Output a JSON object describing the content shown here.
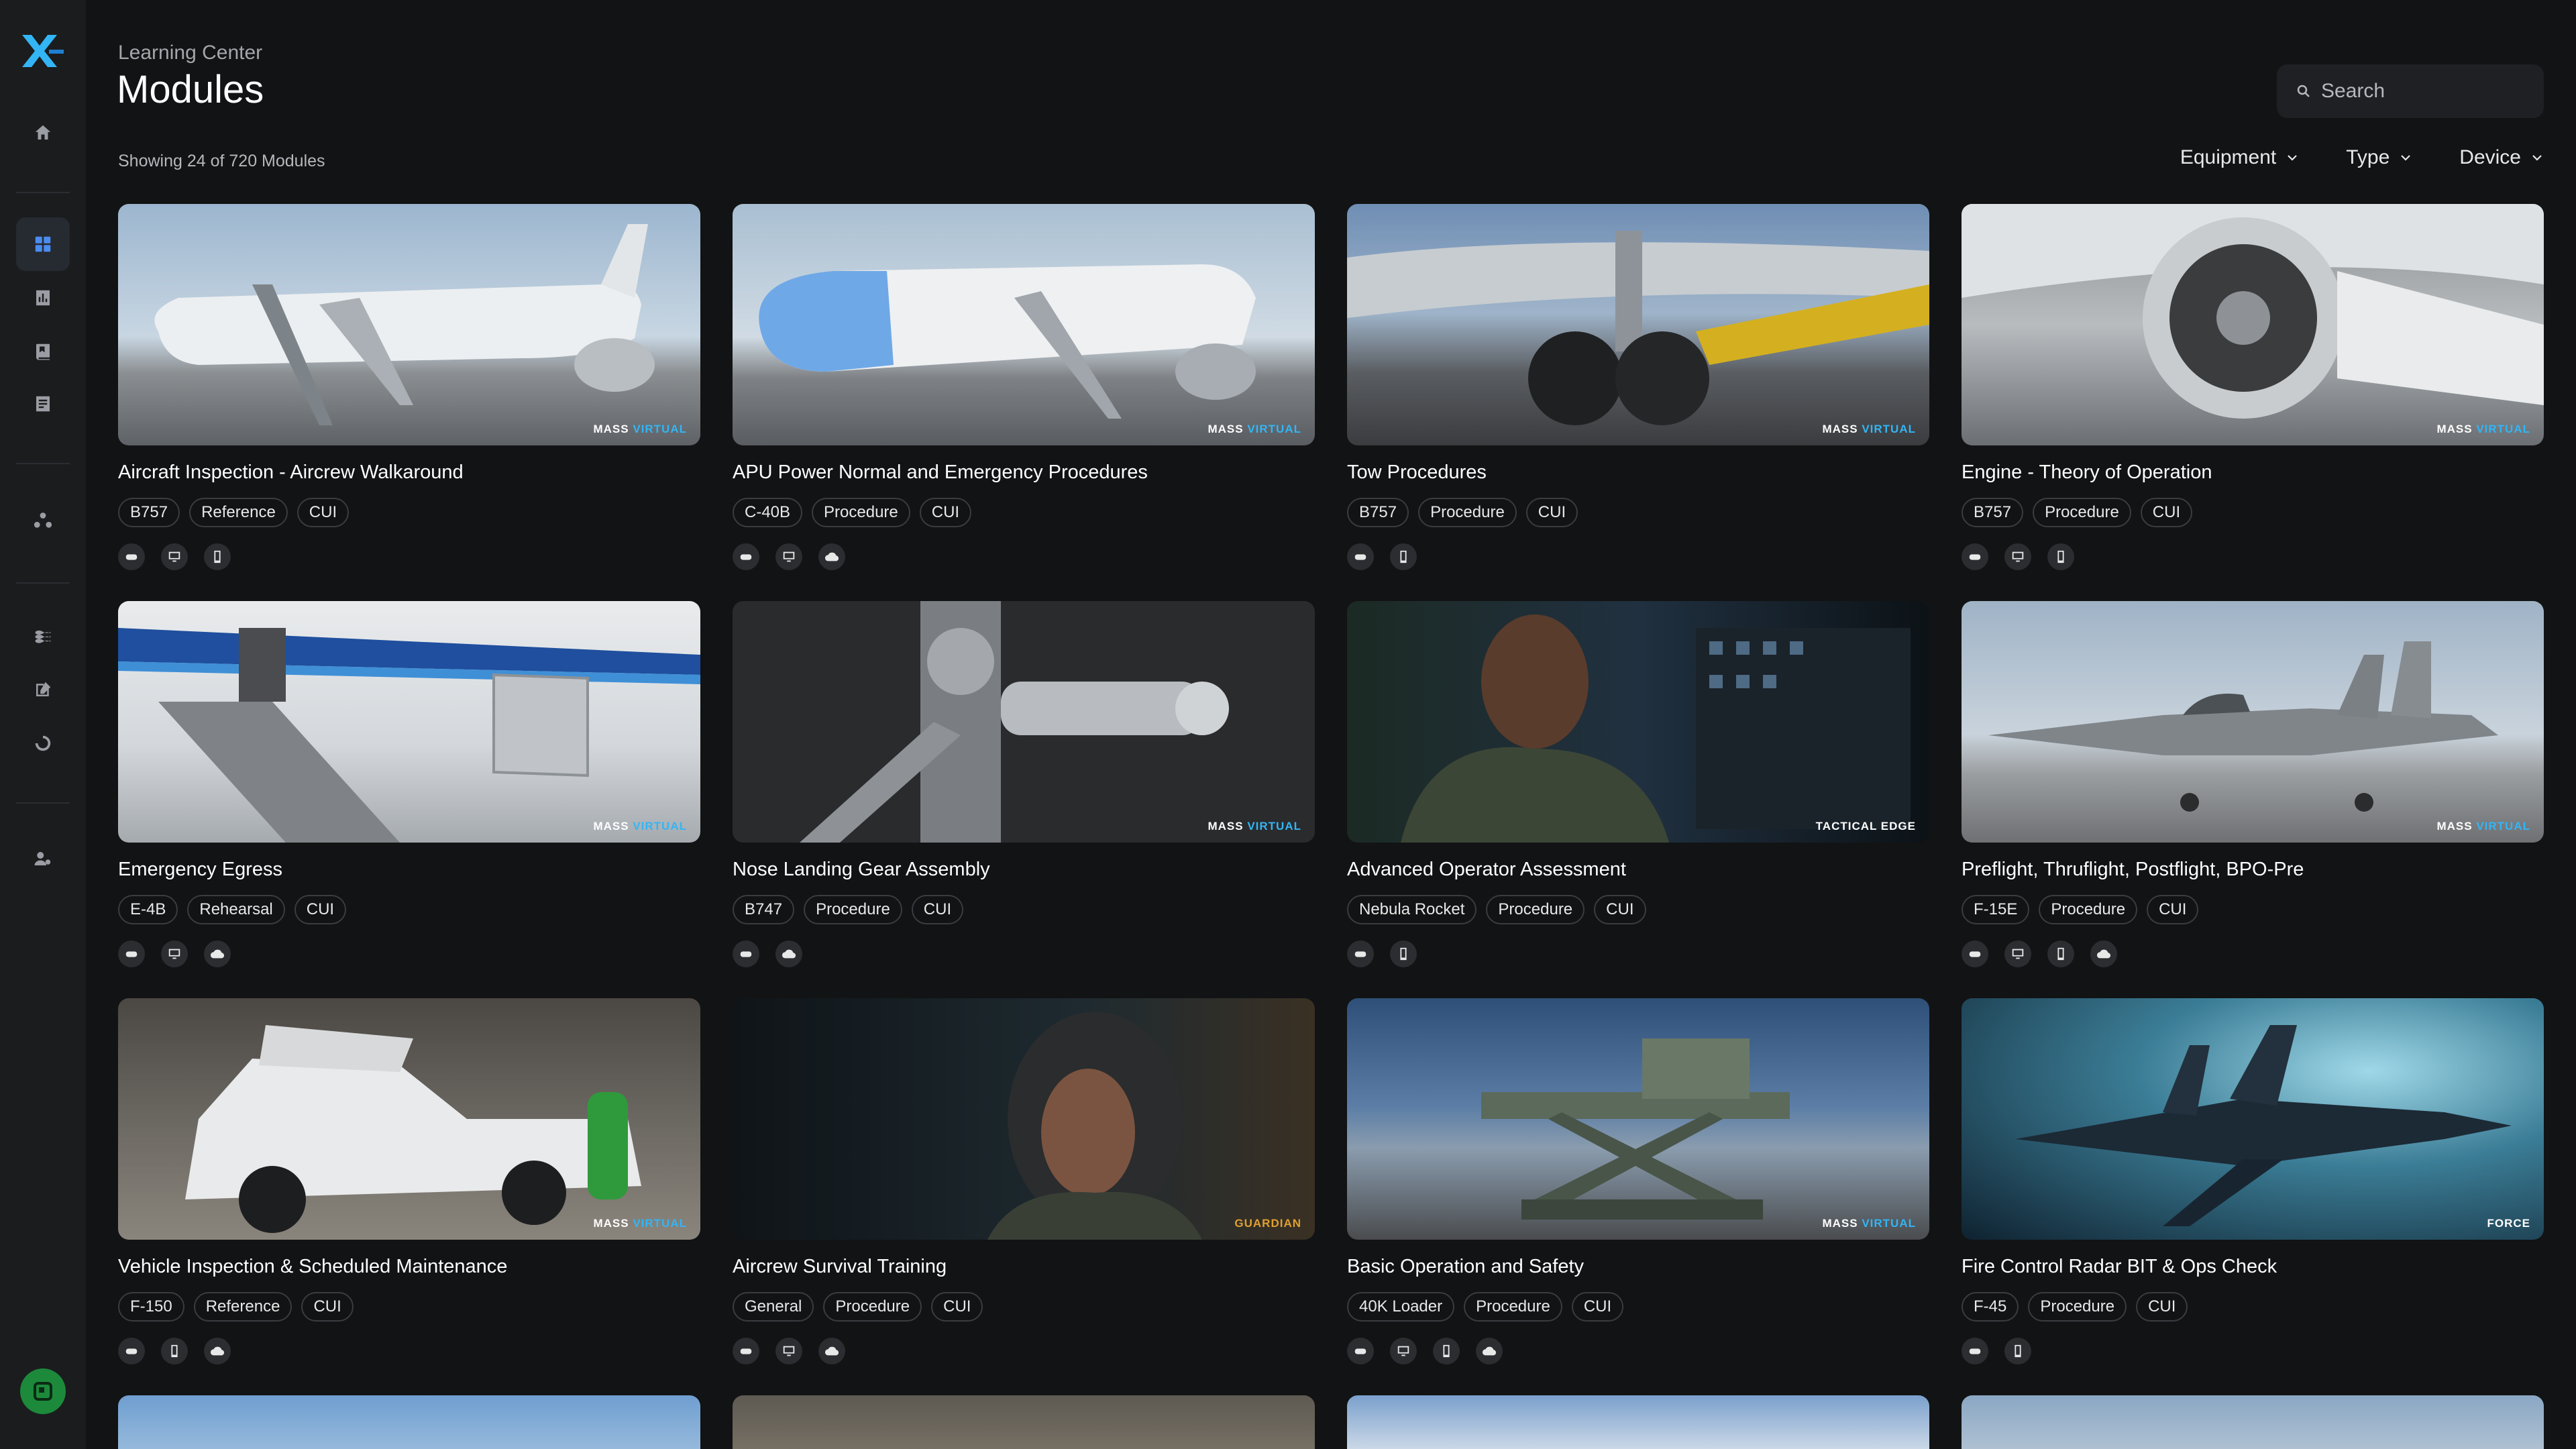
{
  "header": {
    "breadcrumb": "Learning Center",
    "title": "Modules",
    "showing": "Showing 24 of 720 Modules",
    "search_placeholder": "Search",
    "filters": [
      "Equipment",
      "Type",
      "Device"
    ]
  },
  "sidebar": {
    "logo": "XR",
    "items": [
      "home-icon",
      "grid-icon",
      "chart-icon",
      "book-icon",
      "document-icon",
      "network-icon",
      "layers-icon",
      "edit-icon",
      "refresh-icon",
      "users-icon"
    ],
    "active": "grid-icon"
  },
  "watermarks": {
    "mass_a": "MASS",
    "mass_b": "VIRTUAL",
    "tactical": "TACTICAL EDGE",
    "guardian": "GUARDIAN",
    "force": "FORCE"
  },
  "modules": [
    {
      "title": "Aircraft Inspection - Aircrew Walkaround",
      "tags": [
        "B757",
        "Reference",
        "CUI"
      ],
      "devices": [
        "vr",
        "desktop",
        "mobile"
      ]
    },
    {
      "title": "APU Power Normal and Emergency Procedures",
      "tags": [
        "C-40B",
        "Procedure",
        "CUI"
      ],
      "devices": [
        "vr",
        "desktop",
        "cloud"
      ]
    },
    {
      "title": "Tow Procedures",
      "tags": [
        "B757",
        "Procedure",
        "CUI"
      ],
      "devices": [
        "vr",
        "mobile"
      ]
    },
    {
      "title": "Engine - Theory of Operation",
      "tags": [
        "B757",
        "Procedure",
        "CUI"
      ],
      "devices": [
        "vr",
        "desktop",
        "mobile"
      ]
    },
    {
      "title": "Emergency Egress",
      "tags": [
        "E-4B",
        "Rehearsal",
        "CUI"
      ],
      "devices": [
        "vr",
        "desktop",
        "cloud"
      ]
    },
    {
      "title": "Nose Landing Gear Assembly",
      "tags": [
        "B747",
        "Procedure",
        "CUI"
      ],
      "devices": [
        "vr",
        "cloud"
      ]
    },
    {
      "title": "Advanced Operator Assessment",
      "tags": [
        "Nebula Rocket",
        "Procedure",
        "CUI"
      ],
      "devices": [
        "vr",
        "mobile"
      ]
    },
    {
      "title": "Preflight, Thruflight, Postflight, BPO-Pre",
      "tags": [
        "F-15E",
        "Procedure",
        "CUI"
      ],
      "devices": [
        "vr",
        "desktop",
        "mobile",
        "cloud"
      ]
    },
    {
      "title": "Vehicle Inspection & Scheduled Maintenance",
      "tags": [
        "F-150",
        "Reference",
        "CUI"
      ],
      "devices": [
        "vr",
        "mobile",
        "cloud"
      ]
    },
    {
      "title": "Aircrew Survival Training",
      "tags": [
        "General",
        "Procedure",
        "CUI"
      ],
      "devices": [
        "vr",
        "desktop",
        "cloud"
      ]
    },
    {
      "title": "Basic Operation and Safety",
      "tags": [
        "40K Loader",
        "Procedure",
        "CUI"
      ],
      "devices": [
        "vr",
        "desktop",
        "mobile",
        "cloud"
      ]
    },
    {
      "title": "Fire Control Radar BIT & Ops Check",
      "tags": [
        "F-45",
        "Procedure",
        "CUI"
      ],
      "devices": [
        "vr",
        "mobile"
      ]
    }
  ]
}
